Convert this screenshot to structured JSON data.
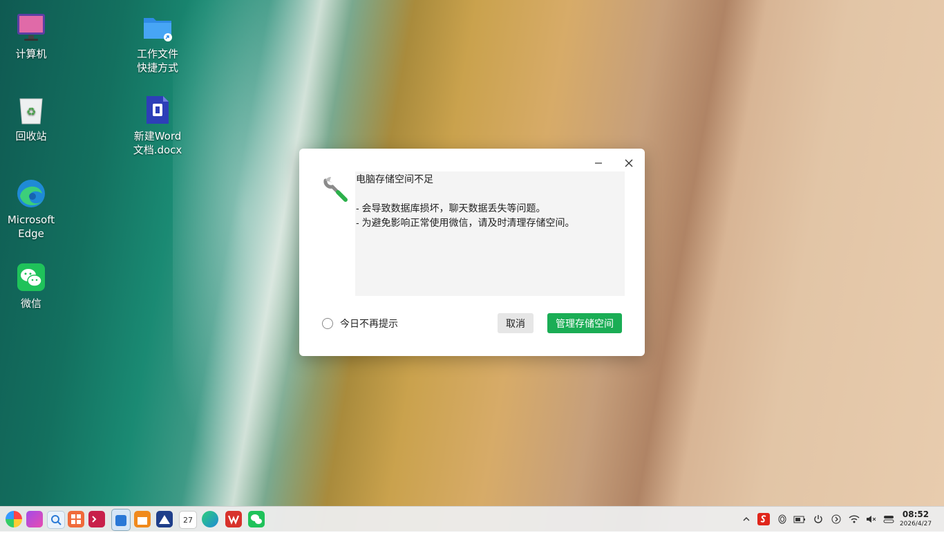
{
  "desktop": {
    "icons": [
      {
        "label": "计算机",
        "icon": "computer-icon"
      },
      {
        "label": "回收站",
        "icon": "recycle-bin-icon"
      },
      {
        "label": "Microsoft\nEdge",
        "icon": "edge-icon"
      },
      {
        "label": "微信",
        "icon": "wechat-icon"
      },
      {
        "label": "工作文件\n快捷方式",
        "icon": "folder-shortcut-icon"
      },
      {
        "label": "新建Word\n文档.docx",
        "icon": "word-doc-icon"
      }
    ]
  },
  "dialog": {
    "title_line": "电脑存储空间不足",
    "line1": "- 会导致数据库损坏，聊天数据丢失等问题。",
    "line2": "- 为避免影响正常使用微信，请及时清理存储空间。",
    "checkbox_label": "今日不再提示",
    "cancel_label": "取消",
    "primary_label": "管理存储空间",
    "colors": {
      "primary": "#1aad55",
      "message_bg": "#f4f4f4"
    }
  },
  "taskbar": {
    "apps": [
      "launcher-icon",
      "notes-icon",
      "search-icon",
      "apps-grid-icon",
      "terminal-icon",
      "app-store-icon",
      "file-manager-icon",
      "image-viewer-icon",
      "calendar-icon",
      "edge-icon",
      "wps-icon",
      "wechat-icon"
    ],
    "calendar_day": "27",
    "tray": [
      "chevron-up-icon",
      "sogou-input-icon",
      "fingerprint-icon",
      "battery-icon",
      "power-icon",
      "arrow-right-circle-icon",
      "wifi-icon",
      "volume-muted-icon",
      "toggle-icon"
    ],
    "time": "08:52",
    "date": "2026/4/27"
  }
}
